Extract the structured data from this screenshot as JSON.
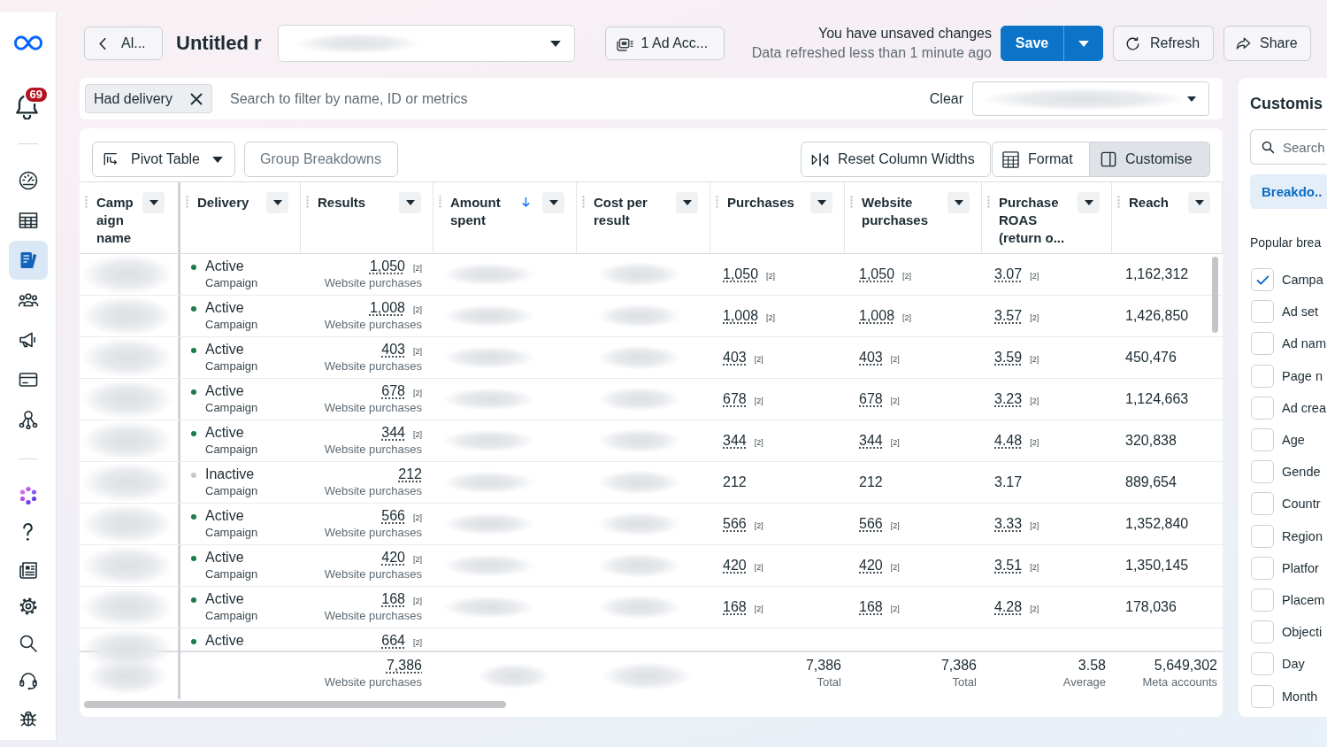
{
  "sidebar": {
    "notification_count": "69",
    "nav_items": [
      {
        "selected": false
      },
      {
        "selected": false
      },
      {
        "selected": true
      },
      {
        "selected": false
      },
      {
        "selected": false
      },
      {
        "selected": false
      },
      {
        "selected": false
      }
    ],
    "tool_items": [
      {
        "selected": false
      },
      {
        "selected": false
      },
      {
        "selected": false
      },
      {
        "selected": false
      },
      {
        "selected": false
      },
      {
        "selected": false
      },
      {
        "selected": false
      }
    ]
  },
  "header": {
    "back_button": "Al...",
    "title": "Untitled r",
    "report_picker": {
      "redacted": true
    },
    "account_button": "1 Ad Acc...",
    "unsaved_message": "You have unsaved changes",
    "refresh_status": "Data refreshed less than 1 minute ago",
    "save_button": "Save",
    "refresh_button": "Refresh",
    "share_button": "Share"
  },
  "filter_bar": {
    "chips": [
      {
        "label": "Had delivery"
      }
    ],
    "search": {
      "placeholder": "Search to filter by name, ID or metrics"
    },
    "clear_button": "Clear",
    "picker": {
      "redacted": true
    }
  },
  "table_toolbar": {
    "buttons": [
      {
        "label": "Pivot Table",
        "kind": "menu",
        "disabled": false
      },
      {
        "label": "Group Breakdowns",
        "kind": "plain",
        "disabled": true
      }
    ],
    "view_buttons": [
      {
        "label": "Reset Column Widths",
        "selected": false
      },
      {
        "label": "Format",
        "selected": false
      },
      {
        "label": "Customise",
        "selected": true
      }
    ]
  },
  "table": {
    "columns": [
      {
        "label": "Campaign name",
        "sorted": false
      },
      {
        "label": "Delivery",
        "sorted": false
      },
      {
        "label": "Results",
        "sorted": false
      },
      {
        "label": "Amount spent",
        "sorted": true
      },
      {
        "label": "Cost per result",
        "sorted": false
      },
      {
        "label": "Purchases",
        "sorted": false
      },
      {
        "label": "Website purchases",
        "sorted": false
      },
      {
        "label": "Purchase ROAS (return o...",
        "sorted": false
      },
      {
        "label": "Reach",
        "sorted": false
      }
    ],
    "rows": [
      {
        "cells": [
          {
            "kind": "redacted"
          },
          {
            "kind": "status",
            "status": "Active",
            "color": "#1b7a4a",
            "detail": "Campaign"
          },
          {
            "kind": "metric",
            "value": "1,050",
            "note": "[2]",
            "caption": "Website purchases"
          },
          {
            "kind": "redacted"
          },
          {
            "kind": "redacted"
          },
          {
            "kind": "metric",
            "value": "1,050",
            "note": "[2]"
          },
          {
            "kind": "metric",
            "value": "1,050",
            "note": "[2]"
          },
          {
            "kind": "metric",
            "value": "3.07",
            "note": "[2]"
          },
          {
            "kind": "metric",
            "value": "1,162,312"
          }
        ]
      },
      {
        "cells": [
          {
            "kind": "redacted"
          },
          {
            "kind": "status",
            "status": "Active",
            "color": "#1b7a4a",
            "detail": "Campaign"
          },
          {
            "kind": "metric",
            "value": "1,008",
            "note": "[2]",
            "caption": "Website purchases"
          },
          {
            "kind": "redacted"
          },
          {
            "kind": "redacted"
          },
          {
            "kind": "metric",
            "value": "1,008",
            "note": "[2]"
          },
          {
            "kind": "metric",
            "value": "1,008",
            "note": "[2]"
          },
          {
            "kind": "metric",
            "value": "3.57",
            "note": "[2]"
          },
          {
            "kind": "metric",
            "value": "1,426,850"
          }
        ]
      },
      {
        "cells": [
          {
            "kind": "redacted"
          },
          {
            "kind": "status",
            "status": "Active",
            "color": "#1b7a4a",
            "detail": "Campaign"
          },
          {
            "kind": "metric",
            "value": "403",
            "note": "[2]",
            "caption": "Website purchases"
          },
          {
            "kind": "redacted"
          },
          {
            "kind": "redacted"
          },
          {
            "kind": "metric",
            "value": "403",
            "note": "[2]"
          },
          {
            "kind": "metric",
            "value": "403",
            "note": "[2]"
          },
          {
            "kind": "metric",
            "value": "3.59",
            "note": "[2]"
          },
          {
            "kind": "metric",
            "value": "450,476"
          }
        ]
      },
      {
        "cells": [
          {
            "kind": "redacted"
          },
          {
            "kind": "status",
            "status": "Active",
            "color": "#1b7a4a",
            "detail": "Campaign"
          },
          {
            "kind": "metric",
            "value": "678",
            "note": "[2]",
            "caption": "Website purchases"
          },
          {
            "kind": "redacted"
          },
          {
            "kind": "redacted"
          },
          {
            "kind": "metric",
            "value": "678",
            "note": "[2]"
          },
          {
            "kind": "metric",
            "value": "678",
            "note": "[2]"
          },
          {
            "kind": "metric",
            "value": "3.23",
            "note": "[2]"
          },
          {
            "kind": "metric",
            "value": "1,124,663"
          }
        ]
      },
      {
        "cells": [
          {
            "kind": "redacted"
          },
          {
            "kind": "status",
            "status": "Active",
            "color": "#1b7a4a",
            "detail": "Campaign"
          },
          {
            "kind": "metric",
            "value": "344",
            "note": "[2]",
            "caption": "Website purchases"
          },
          {
            "kind": "redacted"
          },
          {
            "kind": "redacted"
          },
          {
            "kind": "metric",
            "value": "344",
            "note": "[2]"
          },
          {
            "kind": "metric",
            "value": "344",
            "note": "[2]"
          },
          {
            "kind": "metric",
            "value": "4.48",
            "note": "[2]"
          },
          {
            "kind": "metric",
            "value": "320,838"
          }
        ]
      },
      {
        "cells": [
          {
            "kind": "redacted"
          },
          {
            "kind": "status",
            "status": "Inactive",
            "color": "#c5c9ce",
            "detail": "Campaign"
          },
          {
            "kind": "metric",
            "value": "212",
            "caption": "Website purchases"
          },
          {
            "kind": "redacted"
          },
          {
            "kind": "redacted"
          },
          {
            "kind": "metric",
            "value": "212"
          },
          {
            "kind": "metric",
            "value": "212"
          },
          {
            "kind": "metric",
            "value": "3.17"
          },
          {
            "kind": "metric",
            "value": "889,654"
          }
        ]
      },
      {
        "cells": [
          {
            "kind": "redacted"
          },
          {
            "kind": "status",
            "status": "Active",
            "color": "#1b7a4a",
            "detail": "Campaign"
          },
          {
            "kind": "metric",
            "value": "566",
            "note": "[2]",
            "caption": "Website purchases"
          },
          {
            "kind": "redacted"
          },
          {
            "kind": "redacted"
          },
          {
            "kind": "metric",
            "value": "566",
            "note": "[2]"
          },
          {
            "kind": "metric",
            "value": "566",
            "note": "[2]"
          },
          {
            "kind": "metric",
            "value": "3.33",
            "note": "[2]"
          },
          {
            "kind": "metric",
            "value": "1,352,840"
          }
        ]
      },
      {
        "cells": [
          {
            "kind": "redacted"
          },
          {
            "kind": "status",
            "status": "Active",
            "color": "#1b7a4a",
            "detail": "Campaign"
          },
          {
            "kind": "metric",
            "value": "420",
            "note": "[2]",
            "caption": "Website purchases"
          },
          {
            "kind": "redacted"
          },
          {
            "kind": "redacted"
          },
          {
            "kind": "metric",
            "value": "420",
            "note": "[2]"
          },
          {
            "kind": "metric",
            "value": "420",
            "note": "[2]"
          },
          {
            "kind": "metric",
            "value": "3.51",
            "note": "[2]"
          },
          {
            "kind": "metric",
            "value": "1,350,145"
          }
        ]
      },
      {
        "cells": [
          {
            "kind": "redacted"
          },
          {
            "kind": "status",
            "status": "Active",
            "color": "#1b7a4a",
            "detail": "Campaign"
          },
          {
            "kind": "metric",
            "value": "168",
            "note": "[2]",
            "caption": "Website purchases"
          },
          {
            "kind": "redacted"
          },
          {
            "kind": "redacted"
          },
          {
            "kind": "metric",
            "value": "168",
            "note": "[2]"
          },
          {
            "kind": "metric",
            "value": "168",
            "note": "[2]"
          },
          {
            "kind": "metric",
            "value": "4.28",
            "note": "[2]"
          },
          {
            "kind": "metric",
            "value": "178,036"
          }
        ]
      },
      {
        "cells": [
          {
            "kind": "redacted"
          },
          {
            "kind": "status",
            "status": "Active",
            "color": "#1b7a4a"
          },
          {
            "kind": "metric",
            "value": "664",
            "note": "[2]"
          }
        ]
      }
    ],
    "totals": {
      "campaign_name": {
        "kind": "redacted"
      },
      "results": {
        "kind": "metric",
        "value": "7,386",
        "caption": "Website purchases"
      },
      "amount_spent": {
        "kind": "redacted"
      },
      "cost_per_result": {
        "kind": "redacted"
      },
      "purchases": {
        "kind": "metric",
        "value": "7,386",
        "caption": "Total"
      },
      "website_purchases": {
        "kind": "metric",
        "value": "7,386",
        "caption": "Total"
      },
      "purchase_roas": {
        "kind": "metric",
        "value": "3.58",
        "caption": "Average"
      },
      "reach": {
        "kind": "metric",
        "value": "5,649,302",
        "caption": "Meta accounts"
      }
    }
  },
  "customise_panel": {
    "title": "Customis",
    "search": {
      "placeholder": "Search"
    },
    "tabs": [
      {
        "label": "Breakdo..",
        "selected": true
      }
    ],
    "section_title": "Popular brea",
    "breakdowns": [
      {
        "label": "Campa",
        "checked": true
      },
      {
        "label": "Ad set",
        "checked": false
      },
      {
        "label": "Ad nam",
        "checked": false
      },
      {
        "label": "Page n",
        "checked": false
      },
      {
        "label": "Ad crea",
        "checked": false
      },
      {
        "label": "Age",
        "checked": false
      },
      {
        "label": "Gende",
        "checked": false
      },
      {
        "label": "Countr",
        "checked": false
      },
      {
        "label": "Region",
        "checked": false
      },
      {
        "label": "Platfor",
        "checked": false
      },
      {
        "label": "Placem",
        "checked": false
      },
      {
        "label": "Objecti",
        "checked": false
      },
      {
        "label": "Day",
        "checked": false
      },
      {
        "label": "Month",
        "checked": false
      }
    ]
  }
}
